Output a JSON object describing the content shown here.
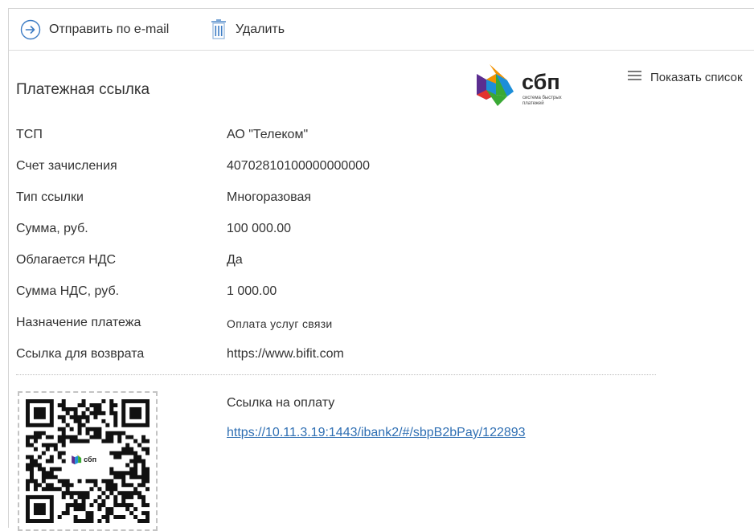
{
  "toolbar": {
    "send_email_label": "Отправить по e-mail",
    "delete_label": "Удалить"
  },
  "header": {
    "title": "Платежная ссылка",
    "logo_text": "сбп",
    "logo_subtext_1": "система быстрых",
    "logo_subtext_2": "платежей",
    "show_list_label": "Показать список"
  },
  "details": [
    {
      "label": "ТСП",
      "value": "АО \"Телеком\""
    },
    {
      "label": "Счет зачисления",
      "value": "40702810100000000000"
    },
    {
      "label": "Тип ссылки",
      "value": "Многоразовая"
    },
    {
      "label": "Сумма, руб.",
      "value": "100 000.00"
    },
    {
      "label": "Облагается НДС",
      "value": "Да"
    },
    {
      "label": "Сумма НДС, руб.",
      "value": "1 000.00"
    },
    {
      "label": "Назначение платежа",
      "value": "Оплата услуг связи"
    },
    {
      "label": "Ссылка для возврата",
      "value": "https://www.bifit.com"
    }
  ],
  "payment": {
    "title": "Ссылка на оплату",
    "url": "https://10.11.3.19:1443/ibank2/#/sbpB2bPay/122893",
    "qr_logo_text": "сбп"
  },
  "colors": {
    "link": "#2f6fb3",
    "separator": "#bdbdbd",
    "sbp_purple": "#5b2d90",
    "sbp_blue": "#1d8ed8",
    "sbp_green": "#3aa935",
    "sbp_orange": "#f39200",
    "sbp_red": "#e3342f"
  }
}
